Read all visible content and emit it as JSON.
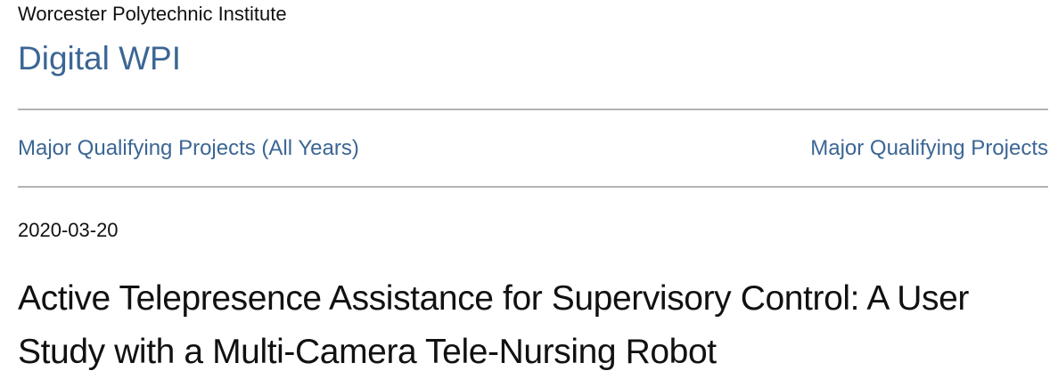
{
  "header": {
    "institution": "Worcester Polytechnic Institute",
    "site_title": "Digital WPI"
  },
  "breadcrumb": {
    "left_link": "Major Qualifying Projects (All Years)",
    "right_link": "Major Qualifying Projects"
  },
  "item": {
    "date": "2020-03-20",
    "title": "Active Telepresence Assistance for Supervisory Control: A User Study with a Multi-Camera Tele-Nursing Robot"
  },
  "colors": {
    "link": "#3b6694",
    "text": "#111111",
    "rule": "#b3b3b3"
  }
}
